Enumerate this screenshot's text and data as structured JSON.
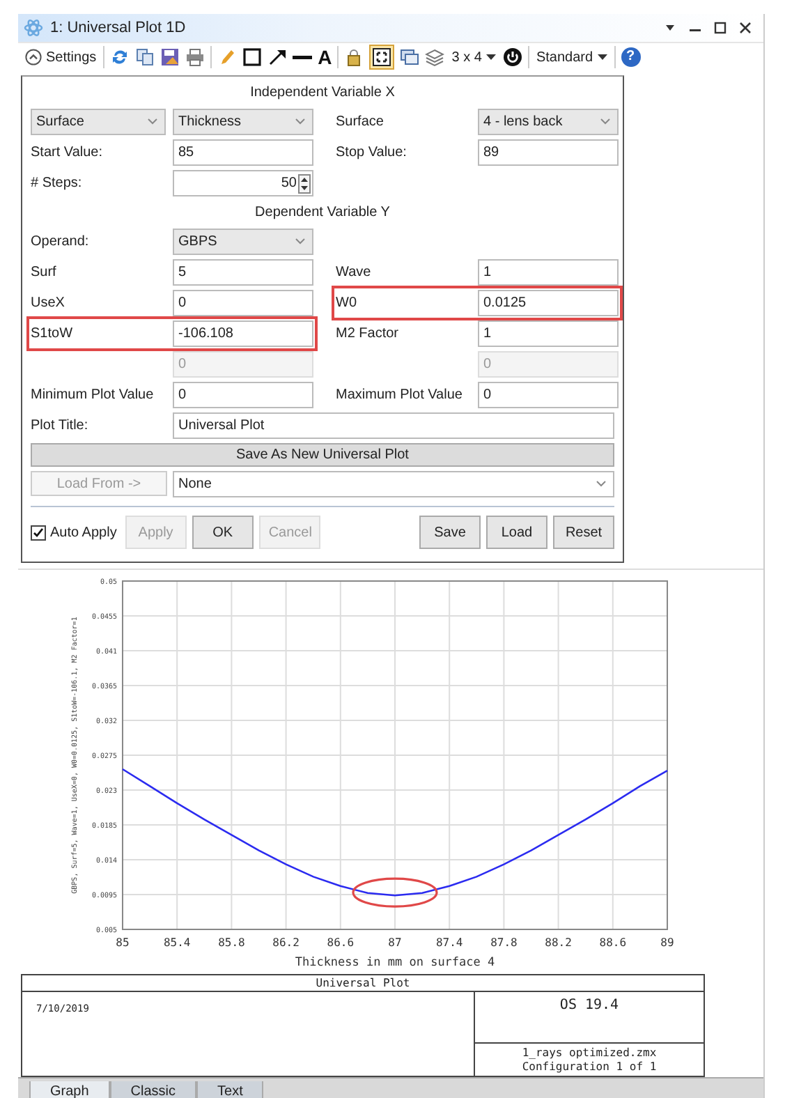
{
  "window": {
    "title": "1: Universal Plot 1D"
  },
  "toolbar": {
    "settings_label": "Settings",
    "text_tool": "A",
    "grid_toggle_on": true,
    "layout_label": "3 x 4",
    "style_label": "Standard",
    "help": "?"
  },
  "form_rows": [
    {
      "kind": "heading",
      "text": "Independent Variable X"
    },
    {
      "kind": "fields",
      "pairs": [
        {
          "cells": [
            {
              "kind": "dropdown",
              "value": "Surface"
            },
            {
              "kind": "dropdown",
              "value": "Thickness"
            }
          ]
        },
        {
          "cells": [
            {
              "kind": "label",
              "text": "Surface"
            },
            {
              "kind": "dropdown",
              "value": "4 - lens back"
            }
          ]
        }
      ]
    },
    {
      "kind": "fields",
      "pairs": [
        {
          "cells": [
            {
              "kind": "label",
              "text": "Start Value:"
            },
            {
              "kind": "input",
              "value": "85",
              "disabled": false
            }
          ]
        },
        {
          "cells": [
            {
              "kind": "label",
              "text": "Stop Value:"
            },
            {
              "kind": "input",
              "value": "89",
              "disabled": false
            }
          ]
        }
      ]
    },
    {
      "kind": "fields",
      "pairs": [
        {
          "cells": [
            {
              "kind": "label",
              "text": "# Steps:"
            },
            {
              "kind": "spinner",
              "value": "50"
            }
          ]
        }
      ]
    },
    {
      "kind": "heading",
      "text": "Dependent Variable Y"
    },
    {
      "kind": "fields",
      "pairs": [
        {
          "cells": [
            {
              "kind": "label",
              "text": "Operand:"
            },
            {
              "kind": "dropdown",
              "value": "GBPS"
            }
          ]
        }
      ]
    },
    {
      "kind": "fields",
      "pairs": [
        {
          "cells": [
            {
              "kind": "label",
              "text": "Surf"
            },
            {
              "kind": "input",
              "value": "5",
              "disabled": false
            }
          ]
        },
        {
          "cells": [
            {
              "kind": "label",
              "text": "Wave"
            },
            {
              "kind": "input",
              "value": "1",
              "disabled": false
            }
          ]
        }
      ]
    },
    {
      "kind": "fields",
      "pairs": [
        {
          "cells": [
            {
              "kind": "label",
              "text": "UseX"
            },
            {
              "kind": "input",
              "value": "0",
              "disabled": false
            }
          ]
        },
        {
          "highlighted": true,
          "cells": [
            {
              "kind": "label",
              "text": "W0"
            },
            {
              "kind": "input",
              "value": "0.0125",
              "disabled": false
            }
          ]
        }
      ]
    },
    {
      "kind": "fields",
      "pairs": [
        {
          "highlighted": true,
          "cells": [
            {
              "kind": "label",
              "text": "S1toW"
            },
            {
              "kind": "input",
              "value": "-106.108",
              "disabled": false
            }
          ]
        },
        {
          "cells": [
            {
              "kind": "label",
              "text": "M2 Factor"
            },
            {
              "kind": "input",
              "value": "1",
              "disabled": false
            }
          ]
        }
      ]
    },
    {
      "kind": "fields",
      "pairs": [
        {
          "cells": [
            {
              "kind": "input",
              "value": "0",
              "disabled": true
            }
          ]
        },
        {
          "cells": [
            {
              "kind": "input",
              "value": "0",
              "disabled": true
            }
          ]
        }
      ]
    },
    {
      "kind": "fields",
      "pairs": [
        {
          "cells": [
            {
              "kind": "label",
              "text": "Minimum Plot Value"
            },
            {
              "kind": "input",
              "value": "0",
              "disabled": false
            }
          ]
        },
        {
          "cells": [
            {
              "kind": "label",
              "text": "Maximum Plot Value"
            },
            {
              "kind": "input",
              "value": "0",
              "disabled": false
            }
          ]
        }
      ]
    },
    {
      "kind": "wide",
      "label": "Plot Title:",
      "value": "Universal Plot"
    }
  ],
  "save_as_button": "Save As New Universal Plot",
  "load_from": {
    "button": "Load From ->",
    "disabled": true,
    "value": "None"
  },
  "auto_apply": {
    "label": "Auto Apply",
    "checked": true
  },
  "left_buttons": [
    {
      "label": "Apply",
      "disabled": true
    },
    {
      "label": "OK",
      "disabled": false
    },
    {
      "label": "Cancel",
      "disabled": true
    }
  ],
  "right_buttons": [
    {
      "label": "Save",
      "disabled": false
    },
    {
      "label": "Load",
      "disabled": false
    },
    {
      "label": "Reset",
      "disabled": false
    }
  ],
  "plot": {
    "minimum_circled": true,
    "chart_data": {
      "type": "line",
      "xlabel": "Thickness in mm on surface 4",
      "ylabel": "GBPS, Surf=5, Wave=1, UseX=0, W0=0.0125, S1toW=-106.1, M2 Factor=1",
      "grid": true,
      "x": [
        85,
        85.2,
        85.4,
        85.6,
        85.8,
        86,
        86.2,
        86.4,
        86.6,
        86.8,
        87,
        87.2,
        87.4,
        87.6,
        87.8,
        88,
        88.2,
        88.4,
        88.6,
        88.8,
        89
      ],
      "series": [
        {
          "color": "#2b2bf0",
          "values": [
            0.0257,
            0.0235,
            0.0213,
            0.0192,
            0.0172,
            0.0152,
            0.0134,
            0.0118,
            0.0106,
            0.0097,
            0.0094,
            0.0097,
            0.0106,
            0.0118,
            0.0134,
            0.0152,
            0.0172,
            0.0192,
            0.0213,
            0.0235,
            0.0255
          ]
        }
      ],
      "xlim": [
        85,
        89
      ],
      "ylim": [
        0.005,
        0.05
      ],
      "xticks": [
        85,
        85.4,
        85.8,
        86.2,
        86.6,
        87,
        87.4,
        87.8,
        88.2,
        88.6,
        89
      ],
      "yticks": [
        0.005,
        0.0095,
        0.014,
        0.0185,
        0.023,
        0.0275,
        0.032,
        0.0365,
        0.041,
        0.0455,
        0.05
      ]
    }
  },
  "footer": {
    "title": "Universal Plot",
    "date": "7/10/2019",
    "version": "OS 19.4",
    "file": "1_rays optimized.zmx",
    "configuration": "Configuration 1 of 1"
  },
  "tabs": [
    {
      "label": "Graph",
      "selected": true
    },
    {
      "label": "Classic",
      "selected": false
    },
    {
      "label": "Text",
      "selected": false
    }
  ]
}
